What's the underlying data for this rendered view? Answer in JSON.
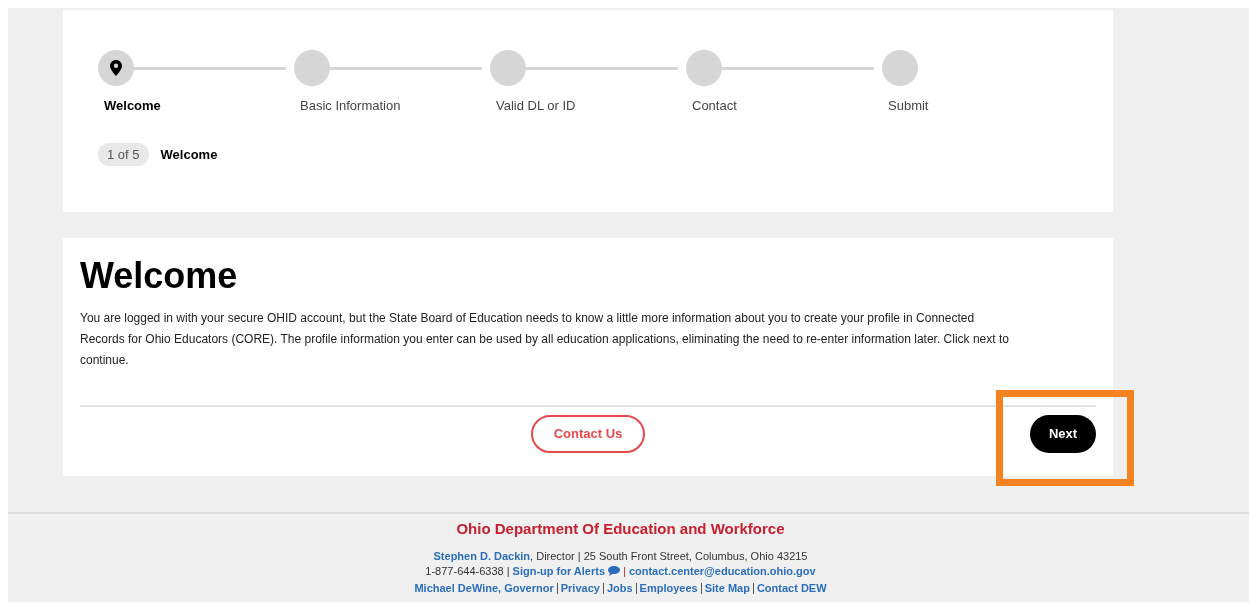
{
  "steps": [
    {
      "label": "Welcome",
      "selected": true
    },
    {
      "label": "Basic Information",
      "selected": false
    },
    {
      "label": "Valid DL or ID",
      "selected": false
    },
    {
      "label": "Contact",
      "selected": false
    },
    {
      "label": "Submit",
      "selected": false
    }
  ],
  "progress": {
    "count": "1 of 5",
    "current": "Welcome"
  },
  "content": {
    "heading": "Welcome",
    "body": "You are logged in with your secure OHID account, but the State Board of Education needs to know a little more information about you to create your profile in Connected Records for Ohio Educators (CORE). The profile information you enter can be used by all education applications, eliminating the need to re-enter information later. Click next to continue."
  },
  "contact_button": "Contact Us",
  "next_button": {
    "label": "Next",
    "highlighted": true
  },
  "footer": {
    "title": "Ohio Department Of Education and Workforce",
    "director_link": "Stephen D. Dackin",
    "director_text": ", Director | 25 South Front Street, Columbus, Ohio 43215",
    "phone": "1-877-644-6338 |",
    "alerts_link": "Sign-up for Alerts",
    "separator": "|",
    "email_link": "contact.center@education.ohio.gov",
    "links": [
      "Michael DeWine, Governor",
      "Privacy",
      "Jobs",
      "Employees",
      "Site Map",
      "Contact DEW"
    ]
  }
}
